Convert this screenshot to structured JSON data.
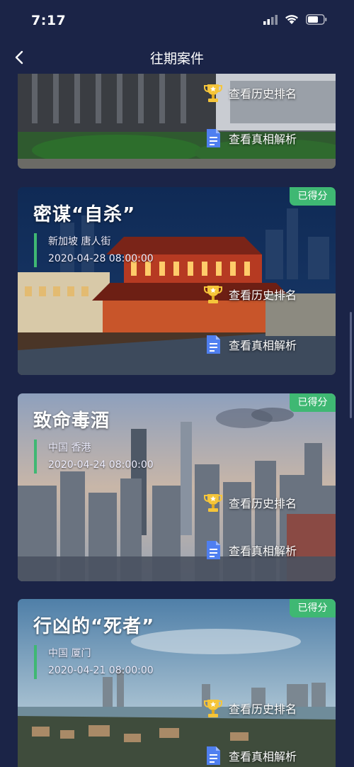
{
  "status": {
    "time": "7:17"
  },
  "nav": {
    "title": "往期案件"
  },
  "cards": [
    {
      "title": "",
      "location": "",
      "datetime": "",
      "badge": "",
      "rank_label": "查看历史排名",
      "truth_label": "查看真相解析"
    },
    {
      "title": "密谋“自杀”",
      "location": "新加坡 唐人街",
      "datetime": "2020-04-28 08:00:00",
      "badge": "已得分",
      "rank_label": "查看历史排名",
      "truth_label": "查看真相解析"
    },
    {
      "title": "致命毒酒",
      "location": "中国 香港",
      "datetime": "2020-04-24 08:00:00",
      "badge": "已得分",
      "rank_label": "查看历史排名",
      "truth_label": "查看真相解析"
    },
    {
      "title": "行凶的“死者”",
      "location": "中国 厦门",
      "datetime": "2020-04-21 08:00:00",
      "badge": "已得分",
      "rank_label": "查看历史排名",
      "truth_label": "查看真相解析"
    }
  ],
  "colors": {
    "background": "#1b2447",
    "badge": "#3fb873",
    "accent_bar": "#3fb873",
    "doc_icon": "#4f7ff0",
    "trophy": "#f5c53a"
  }
}
